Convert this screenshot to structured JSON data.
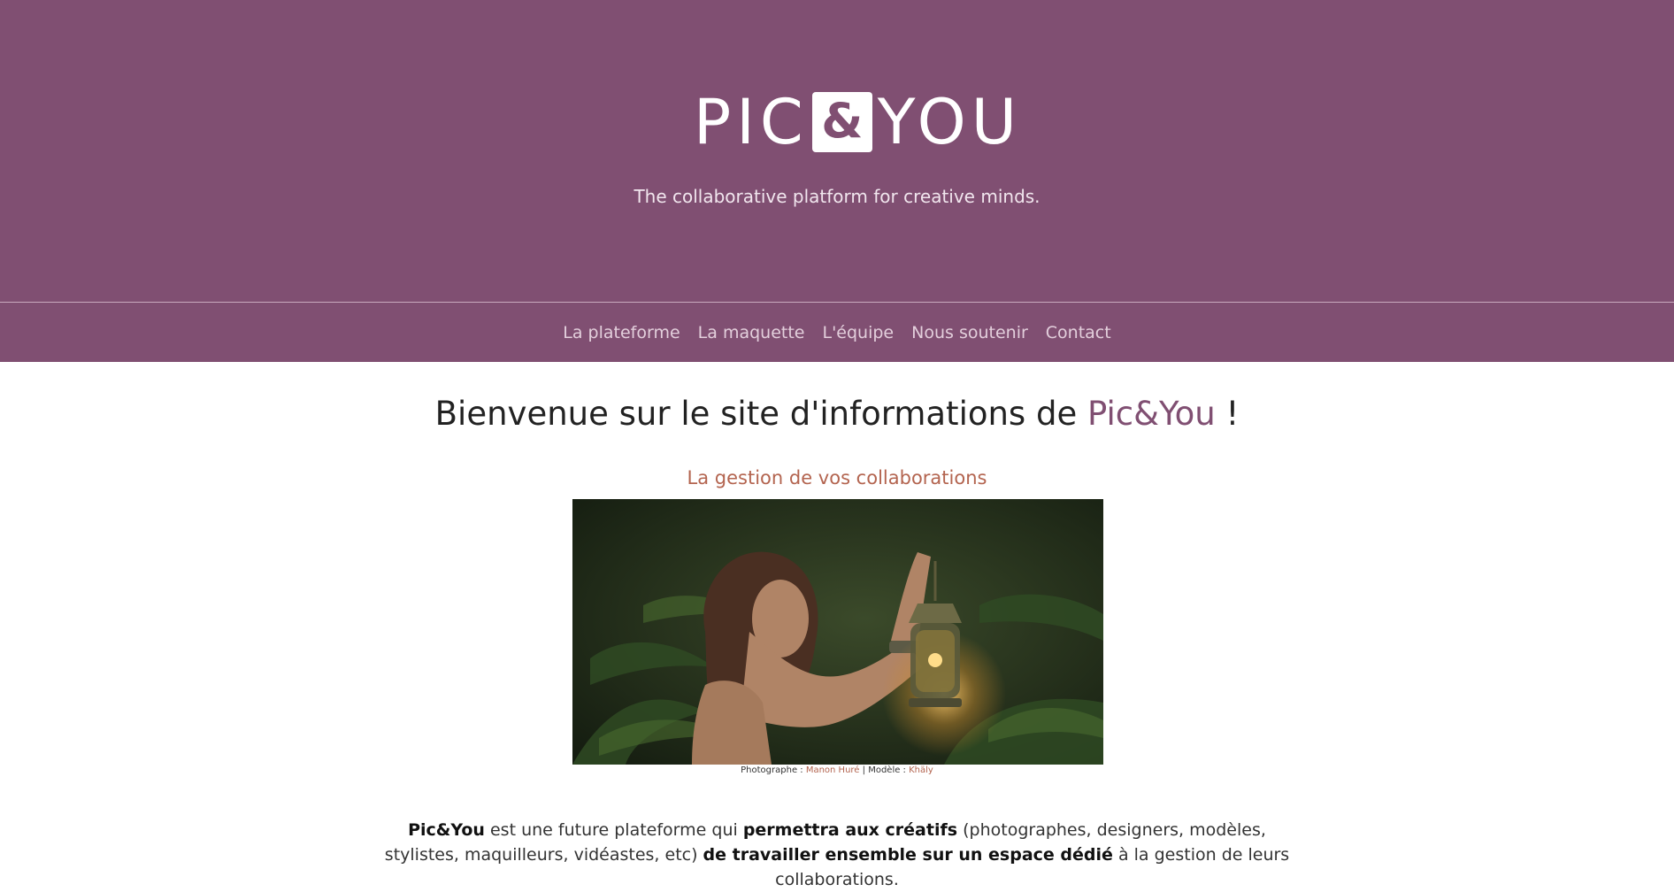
{
  "header": {
    "logo": {
      "left": "PIC",
      "amp": "&",
      "right": "YOU"
    },
    "tagline": "The collaborative platform for creative minds."
  },
  "nav": {
    "items": [
      {
        "label": "La plateforme"
      },
      {
        "label": "La maquette"
      },
      {
        "label": "L'équipe"
      },
      {
        "label": "Nous soutenir"
      },
      {
        "label": "Contact"
      }
    ]
  },
  "main": {
    "welcome": {
      "prefix": "Bienvenue sur le site d'informations de ",
      "brand": "Pic&You",
      "suffix": " !"
    },
    "subheading": "La gestion de vos collaborations",
    "caption": {
      "photographer_label": "Photographe : ",
      "photographer": "Manon Huré",
      "separator": " | ",
      "model_label": "Modèle : ",
      "model": "Khäly"
    },
    "intro": {
      "p1": "Pic&You",
      "p2": " est une future plateforme qui ",
      "p3": "permettra aux créatifs",
      "p4": " (photographes, designers, modèles, stylistes, maquilleurs, vidéastes, etc) ",
      "p5": "de travailler ensemble sur un espace dédié",
      "p6": " à la gestion de leurs collaborations."
    }
  },
  "colors": {
    "brand_purple": "#804f72",
    "accent_terracotta": "#b3644f",
    "text_dark": "#222222"
  }
}
